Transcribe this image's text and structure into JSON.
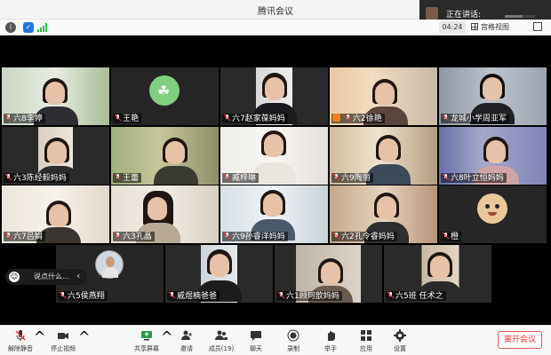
{
  "window": {
    "title": "腾讯会议"
  },
  "speaking": {
    "label": "正在讲话:"
  },
  "infobar": {
    "timer": "04:24",
    "view_label": "宫格视图"
  },
  "participants": [
    {
      "name": "六8李婷"
    },
    {
      "name": "王艳"
    },
    {
      "name": "六7赵家葆妈妈"
    },
    {
      "name": "六2徐艳"
    },
    {
      "name": "龙城小学周亚军"
    },
    {
      "name": "六3陈经毅妈妈"
    },
    {
      "name": "王蕾"
    },
    {
      "name": "臧梓琳"
    },
    {
      "name": "六9陶丽"
    },
    {
      "name": "六8叶立恒妈妈"
    },
    {
      "name": "六7吕娟"
    },
    {
      "name": "六3孔晶"
    },
    {
      "name": "六9孙睿洋妈妈"
    },
    {
      "name": "六2孔令睿妈妈"
    },
    {
      "name": "橙"
    },
    {
      "name": "六5侯燕翔"
    },
    {
      "name": "戚煜楠爸爸"
    },
    {
      "name": "六1顾珂歆妈妈"
    },
    {
      "name": "六5班 任术之"
    }
  ],
  "chat": {
    "placeholder": "说点什么..."
  },
  "toolbar": {
    "unmute": "解除静音",
    "stop_video": "停止视频",
    "share": "共享屏幕",
    "invite": "邀请",
    "members": "成员(19)",
    "chat": "聊天",
    "record": "录制",
    "raise_hand": "举手",
    "apps": "应用",
    "settings": "设置",
    "leave": "离开会议"
  },
  "colors": {
    "accent": "#1e77e0",
    "leave": "#e33333",
    "signal": "#2db84d"
  }
}
